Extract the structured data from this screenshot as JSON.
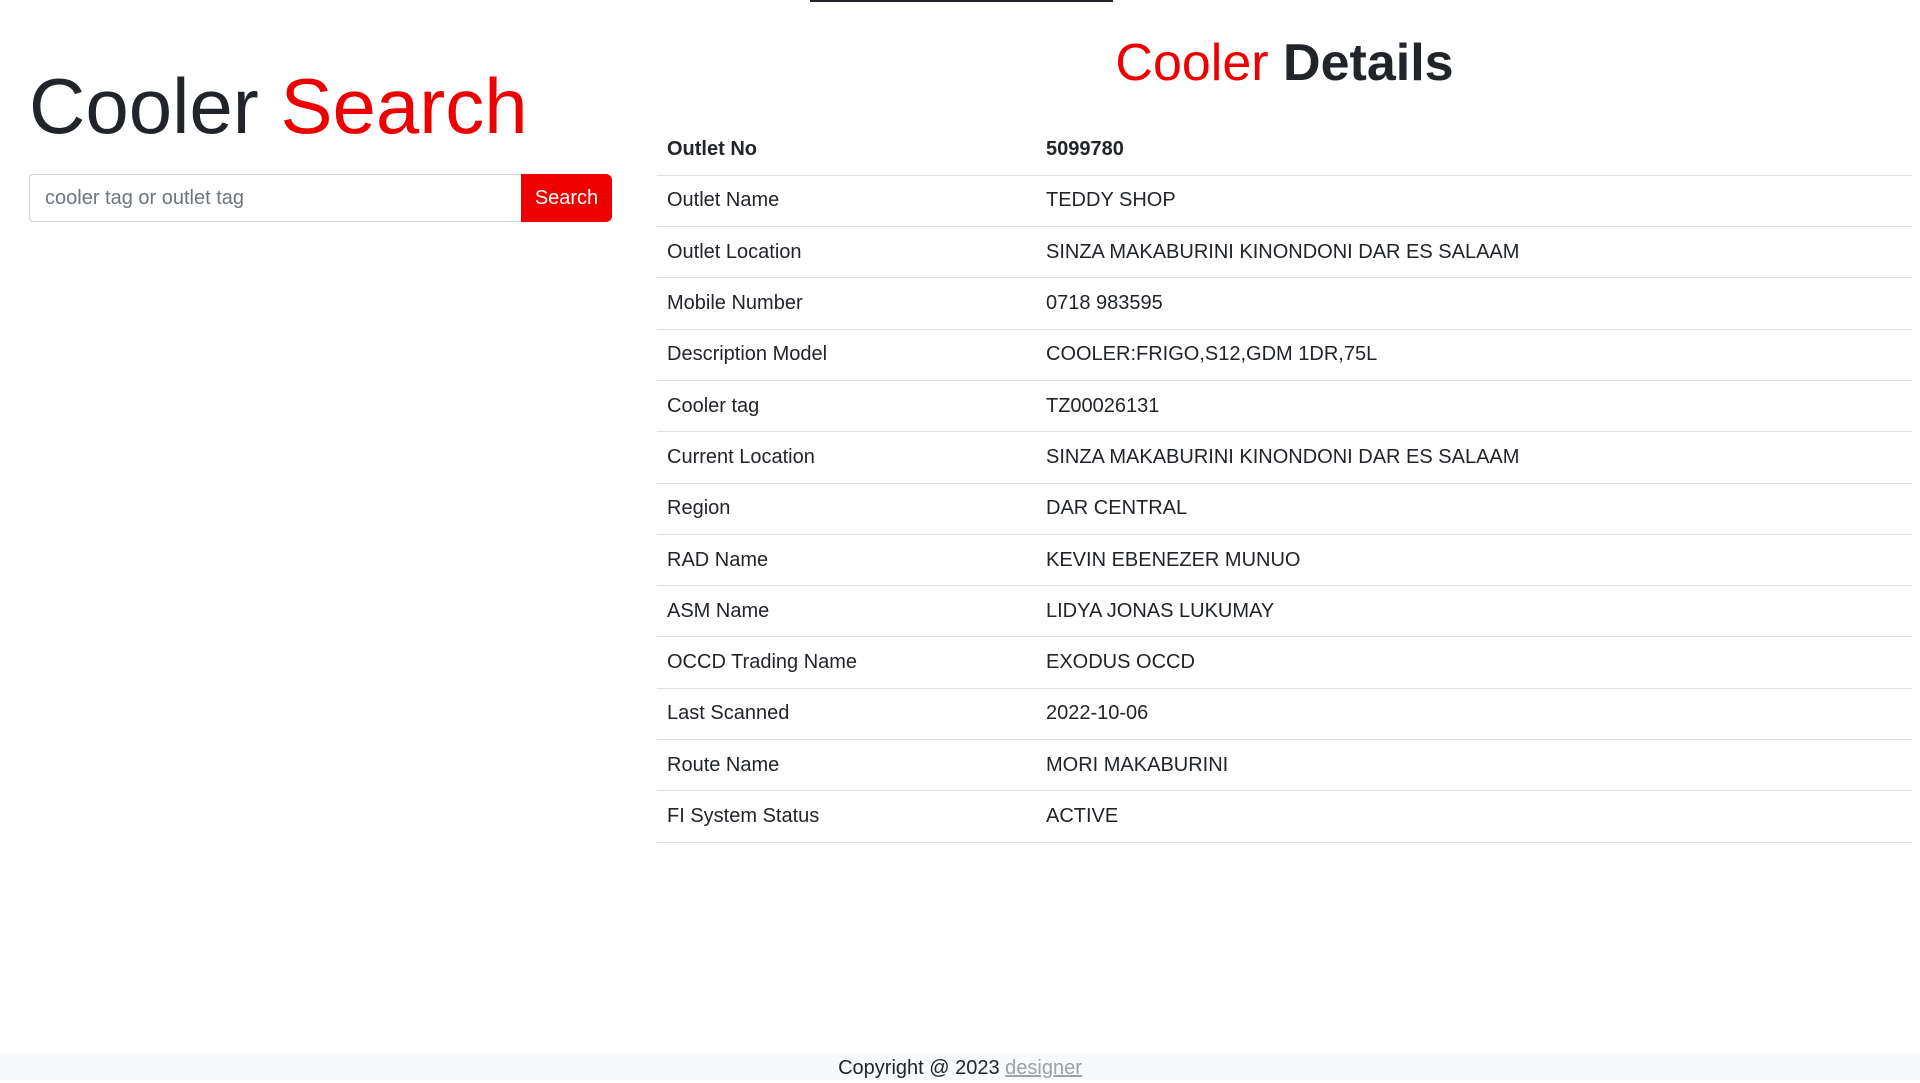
{
  "search": {
    "title_main": "Cooler",
    "title_accent": "Search",
    "placeholder": "cooler tag or outlet tag",
    "button_label": "Search"
  },
  "details": {
    "title_accent": "Cooler",
    "title_main": "Details",
    "rows": [
      {
        "label": "Outlet No",
        "value": "5099780"
      },
      {
        "label": "Outlet Name",
        "value": "TEDDY SHOP"
      },
      {
        "label": "Outlet Location",
        "value": "SINZA MAKABURINI KINONDONI DAR ES SALAAM"
      },
      {
        "label": "Mobile Number",
        "value": "0718 983595"
      },
      {
        "label": "Description Model",
        "value": "COOLER:FRIGO,S12,GDM 1DR,75L"
      },
      {
        "label": "Cooler tag",
        "value": "TZ00026131"
      },
      {
        "label": "Current Location",
        "value": "SINZA MAKABURINI KINONDONI DAR ES SALAAM"
      },
      {
        "label": "Region",
        "value": "DAR CENTRAL"
      },
      {
        "label": "RAD Name",
        "value": "KEVIN EBENEZER MUNUO"
      },
      {
        "label": "ASM Name",
        "value": "LIDYA JONAS LUKUMAY"
      },
      {
        "label": "OCCD Trading Name",
        "value": "EXODUS OCCD"
      },
      {
        "label": "Last Scanned",
        "value": "2022-10-06"
      },
      {
        "label": "Route Name",
        "value": "MORI MAKABURINI"
      },
      {
        "label": "FI System Status",
        "value": "ACTIVE"
      }
    ]
  },
  "footer": {
    "text": "Copyright @ 2023",
    "link_label": "designer"
  },
  "colors": {
    "accent": "#ee0000",
    "text": "#212529",
    "border": "#dee2e6",
    "footer_bg": "#f8f9fa",
    "link": "#9aa0a6"
  }
}
